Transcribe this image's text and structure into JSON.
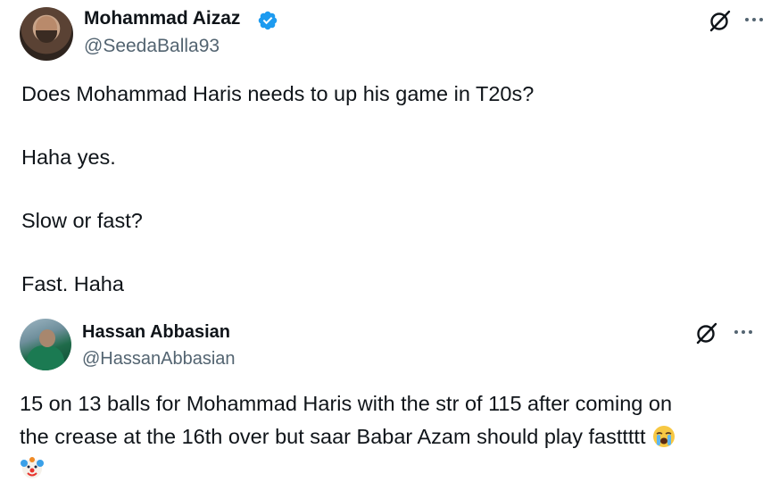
{
  "tweet1": {
    "name": "Mohammad Aizaz",
    "handle": "@SeedaBalla93",
    "verified": true,
    "paragraphs": [
      "Does Mohammad Haris needs to up his game in T20s?",
      "Haha yes.",
      "Slow or fast?",
      "Fast. Haha"
    ],
    "icons": [
      "grok-icon",
      "more-icon",
      "verified-badge-icon"
    ]
  },
  "tweet2": {
    "name": "Hassan Abbasian",
    "handle": "@HassanAbbasian",
    "lines": [
      "15 on 13 balls for Mohammad Haris with the str of 115 after coming on",
      "the crease at the 16th over but saar Babar Azam should play fasttttt"
    ],
    "emojis": [
      "loudly-crying-face-emoji",
      "clown-face-emoji"
    ],
    "icons": [
      "grok-icon",
      "more-icon"
    ]
  },
  "colors": {
    "text": "#0f1419",
    "secondary": "#536471",
    "verified_blue": "#1d9bf0",
    "background": "#ffffff"
  }
}
